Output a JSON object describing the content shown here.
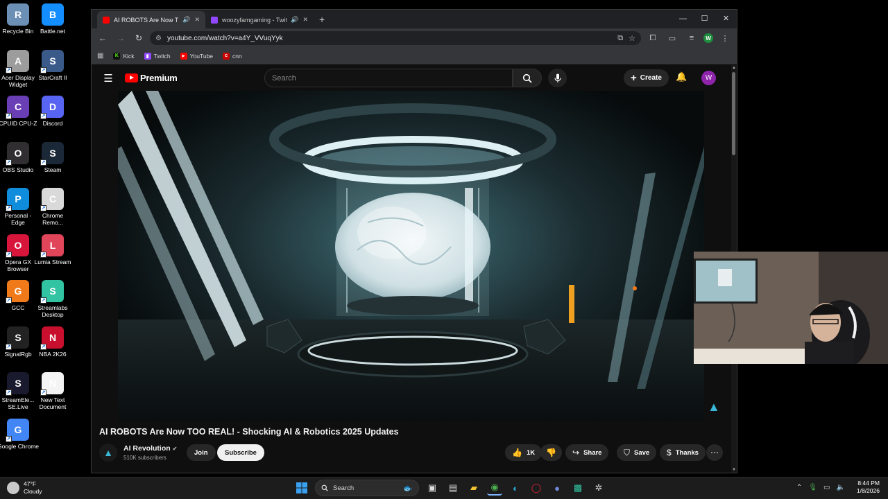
{
  "desktop_icons": [
    {
      "label": "Recycle Bin",
      "icon": "recycle-bin-icon",
      "color": "#6b8fb5"
    },
    {
      "label": "Battle.net",
      "icon": "battlenet-icon",
      "color": "#148eff"
    },
    {
      "label": "Acer Display Widget",
      "icon": "acer-display-icon",
      "color": "#9c9c9c"
    },
    {
      "label": "StarCraft II",
      "icon": "starcraft-icon",
      "color": "#3a5a8a"
    },
    {
      "label": "CPUID CPU-Z",
      "icon": "cpuz-icon",
      "color": "#6a3fb5"
    },
    {
      "label": "Discord",
      "icon": "discord-icon",
      "color": "#5865f2"
    },
    {
      "label": "OBS Studio",
      "icon": "obs-icon",
      "color": "#302e31"
    },
    {
      "label": "Steam",
      "icon": "steam-icon",
      "color": "#1b2838"
    },
    {
      "label": "Personal - Edge",
      "icon": "edge-icon",
      "color": "#0f8ddc"
    },
    {
      "label": "Chrome Remo...",
      "icon": "chrome-remote-icon",
      "color": "#d9d9d9"
    },
    {
      "label": "Opera GX Browser",
      "icon": "opera-gx-icon",
      "color": "#d8163c"
    },
    {
      "label": "Lumia Stream",
      "icon": "lumia-icon",
      "color": "#e0455a"
    },
    {
      "label": "GCC",
      "icon": "gcc-icon",
      "color": "#f07a1a"
    },
    {
      "label": "Streamlabs Desktop",
      "icon": "streamlabs-icon",
      "color": "#31c3a2"
    },
    {
      "label": "SignalRgb",
      "icon": "signalrgb-icon",
      "color": "#222222"
    },
    {
      "label": "NBA 2K26",
      "icon": "nba2k-icon",
      "color": "#c8102e"
    },
    {
      "label": "StreamEle... SE.Live",
      "icon": "streamelements-icon",
      "color": "#1a1a2e"
    },
    {
      "label": "New Text Document",
      "icon": "text-document-icon",
      "color": "#f4f4f4"
    },
    {
      "label": "Google Chrome",
      "icon": "chrome-icon",
      "color": "#4285f4"
    }
  ],
  "browser": {
    "tabs": [
      {
        "title": "AI ROBOTS Are Now TOO R",
        "active": true,
        "favicon_color": "#ff0000"
      },
      {
        "title": "woozyfamgaming - Twitch",
        "active": false,
        "favicon_color": "#9146ff"
      }
    ],
    "new_tab": "+",
    "url": "youtube.com/watch?v=a4Y_VVuqYyk",
    "profile_initial": "W",
    "bookmarks": [
      {
        "label": "Kick",
        "color": "#53fc18",
        "glyph": "K"
      },
      {
        "label": "Twitch",
        "color": "#9146ff",
        "glyph": "▮"
      },
      {
        "label": "YouTube",
        "color": "#ff0000",
        "glyph": "▶"
      },
      {
        "label": "cnn",
        "color": "#cc0000",
        "glyph": "c"
      }
    ]
  },
  "youtube": {
    "brand": "Premium",
    "search_placeholder": "Search",
    "create_label": "Create",
    "avatar_initial": "W",
    "video_title": "AI ROBOTS Are Now TOO REAL! - Shocking AI & Robotics 2025 Updates",
    "channel_name": "AI Revolution",
    "subscribers": "510K subscribers",
    "join_label": "Join",
    "subscribe_label": "Subscribe",
    "like_count": "1K",
    "share_label": "Share",
    "save_label": "Save",
    "thanks_label": "Thanks"
  },
  "taskbar": {
    "temperature": "47°F",
    "condition": "Cloudy",
    "search_label": "Search",
    "time": "8:44 PM",
    "date": "1/8/2026"
  },
  "colors": {
    "youtube_red": "#ff0000",
    "yt_background": "#0f0f0f",
    "chrome_toolbar": "#35363a",
    "accent_cyan": "#3ab8d8"
  }
}
